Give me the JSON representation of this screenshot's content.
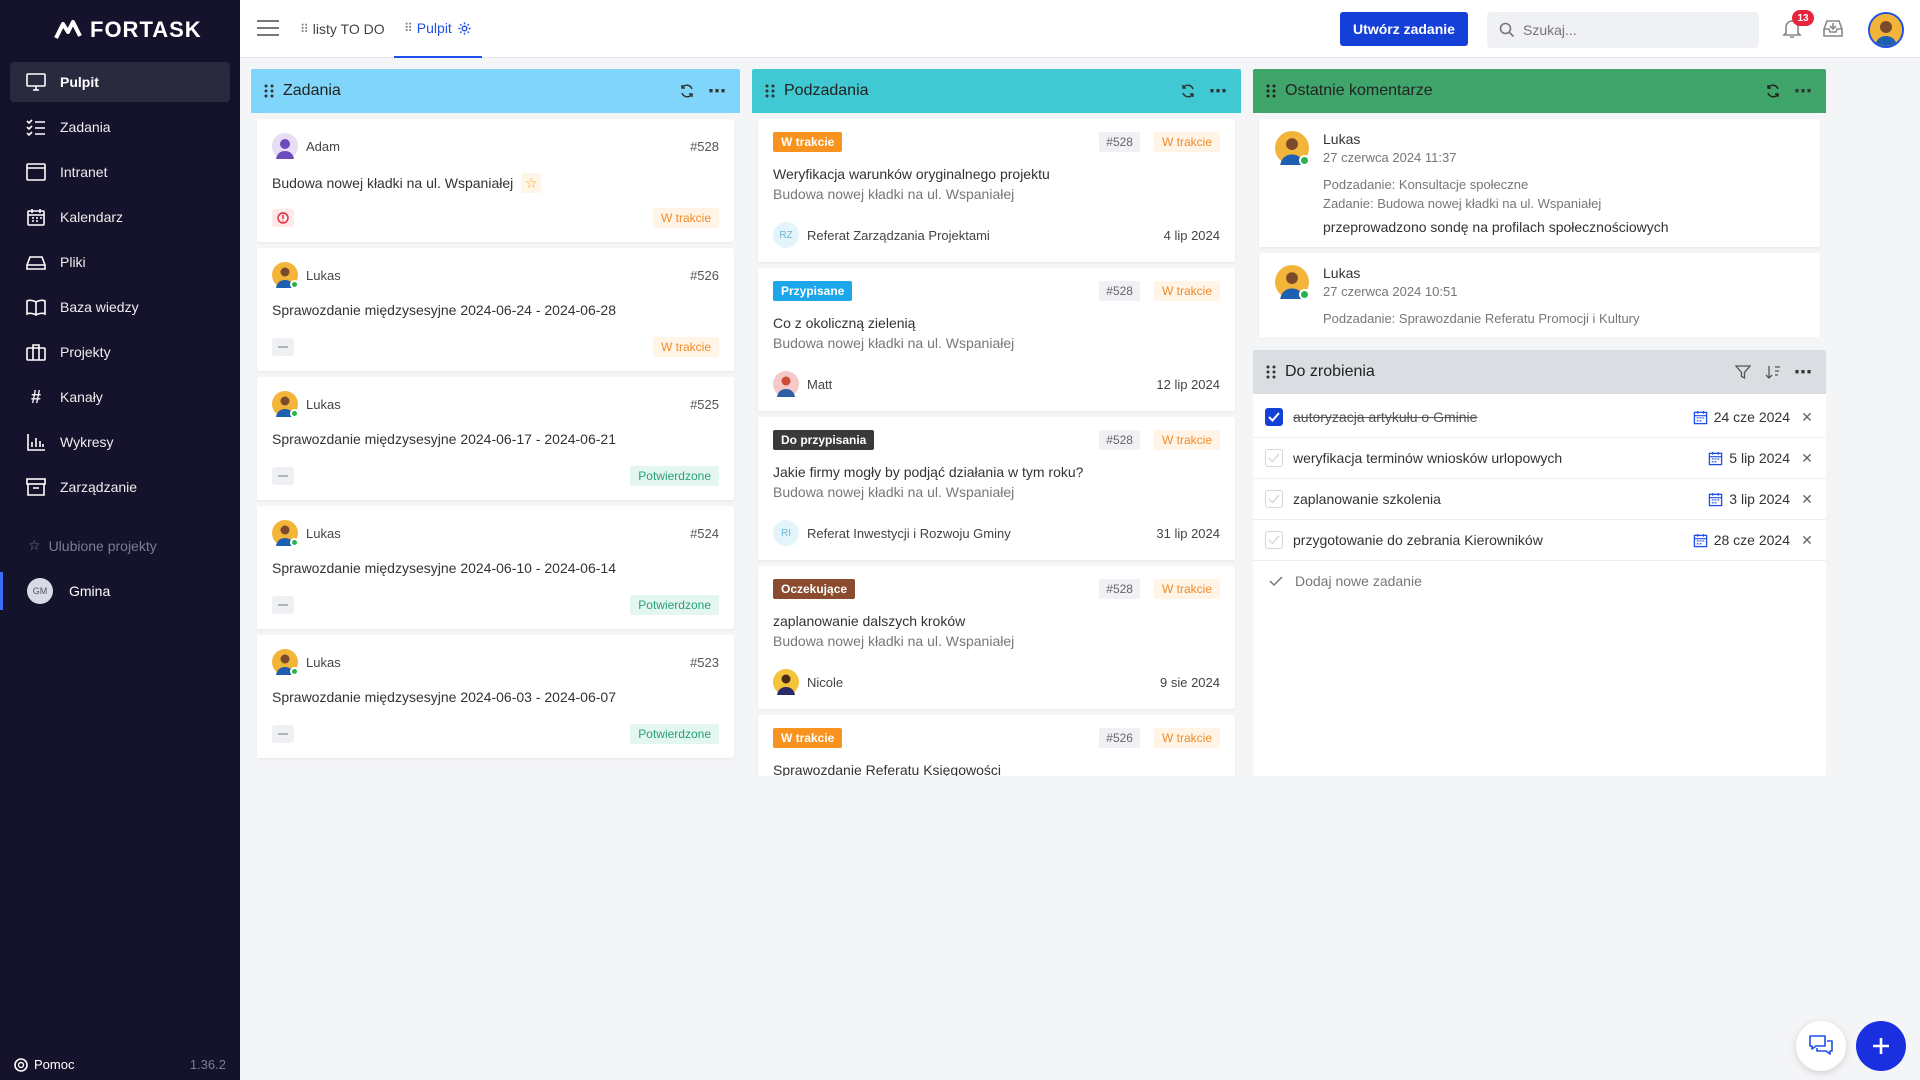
{
  "app": {
    "name": "FORTASK",
    "version": "1.36.2",
    "help_label": "Pomoc"
  },
  "sidebar": {
    "items": [
      {
        "label": "Pulpit",
        "icon": "monitor-icon"
      },
      {
        "label": "Zadania",
        "icon": "list-check-icon"
      },
      {
        "label": "Intranet",
        "icon": "browser-icon"
      },
      {
        "label": "Kalendarz",
        "icon": "calendar-icon"
      },
      {
        "label": "Pliki",
        "icon": "drive-icon"
      },
      {
        "label": "Baza wiedzy",
        "icon": "book-icon"
      },
      {
        "label": "Projekty",
        "icon": "briefcase-icon"
      },
      {
        "label": "Kanały",
        "icon": "hash-icon"
      },
      {
        "label": "Wykresy",
        "icon": "bar-chart-icon"
      },
      {
        "label": "Zarządzanie",
        "icon": "archive-icon"
      }
    ],
    "favorites_title": "Ulubione projekty",
    "project": {
      "initials": "GM",
      "name": "Gmina"
    }
  },
  "topbar": {
    "tabs": [
      {
        "label": "listy TO DO"
      },
      {
        "label": "Pulpit"
      }
    ],
    "create_button": "Utwórz zadanie",
    "search_placeholder": "Szukaj...",
    "notifications_count": "13"
  },
  "widgets": {
    "tasks": {
      "title": "Zadania",
      "header_color": "#7fd6fa",
      "items": [
        {
          "user": "Adam",
          "id": "#528",
          "title": "Budowa nowej kładki na ul. Wspaniałej",
          "starred": true,
          "priority": "high",
          "status": "W trakcie"
        },
        {
          "user": "Lukas",
          "id": "#526",
          "title": "Sprawozdanie międzysesyjne 2024-06-24 - 2024-06-28",
          "priority": "low",
          "status": "W trakcie"
        },
        {
          "user": "Lukas",
          "id": "#525",
          "title": "Sprawozdanie międzysesyjne 2024-06-17 - 2024-06-21",
          "priority": "low",
          "status": "Potwierdzone"
        },
        {
          "user": "Lukas",
          "id": "#524",
          "title": "Sprawozdanie międzysesyjne 2024-06-10 - 2024-06-14",
          "priority": "low",
          "status": "Potwierdzone"
        },
        {
          "user": "Lukas",
          "id": "#523",
          "title": "Sprawozdanie międzysesyjne 2024-06-03 - 2024-06-07",
          "priority": "low",
          "status": "Potwierdzone"
        }
      ]
    },
    "subtasks": {
      "title": "Podzadania",
      "header_color": "#40c9d2",
      "items": [
        {
          "label": "W trakcie",
          "label_color": "orange",
          "id": "#528",
          "status": "W trakcie",
          "title": "Weryfikacja warunków oryginalnego projektu",
          "project": "Budowa nowej kładki na ul. Wspaniałej",
          "assignee_initials": "RZ",
          "assignee": "Referat Zarządzania Projektami",
          "date": "4 lip 2024"
        },
        {
          "label": "Przypisane",
          "label_color": "blue",
          "id": "#528",
          "status": "W trakcie",
          "title": "Co z okoliczną zielenią",
          "project": "Budowa nowej kładki na ul. Wspaniałej",
          "assignee": "Matt",
          "date": "12 lip 2024"
        },
        {
          "label": "Do przypisania",
          "label_color": "dark",
          "id": "#528",
          "status": "W trakcie",
          "title": "Jakie firmy mogły by podjąć działania w tym roku?",
          "project": "Budowa nowej kładki na ul. Wspaniałej",
          "assignee_initials": "RI",
          "assignee": "Referat Inwestycji i Rozwoju Gminy",
          "date": "31 lip 2024"
        },
        {
          "label": "Oczekujące",
          "label_color": "brown",
          "id": "#528",
          "status": "W trakcie",
          "title": "zaplanowanie dalszych kroków",
          "project": "Budowa nowej kładki na ul. Wspaniałej",
          "assignee": "Nicole",
          "date": "9 sie 2024"
        },
        {
          "label": "W trakcie",
          "label_color": "orange",
          "id": "#526",
          "status": "W trakcie",
          "title": "Sprawozdanie Referatu Księgowości"
        }
      ]
    },
    "comments": {
      "title": "Ostatnie komentarze",
      "header_color": "#3fa56a",
      "items": [
        {
          "author": "Lukas",
          "date": "27 czerwca 2024 11:37",
          "subtask": "Podzadanie: Konsultacje społeczne",
          "task": "Zadanie: Budowa nowej kładki na ul. Wspaniałej",
          "text": "przeprowadzono sondę na profilach społecznościowych"
        },
        {
          "author": "Lukas",
          "date": "27 czerwca 2024 10:51",
          "subtask": "Podzadanie: Sprawozdanie Referatu Promocji i Kultury"
        }
      ]
    },
    "todo": {
      "title": "Do zrobienia",
      "header_color": "#dadde2",
      "items": [
        {
          "text": "autoryzacja artykułu o Gminie",
          "done": true,
          "date": "24 cze 2024"
        },
        {
          "text": "weryfikacja terminów wniosków urlopowych",
          "done": false,
          "date": "5 lip 2024"
        },
        {
          "text": "zaplanowanie szkolenia",
          "done": false,
          "date": "3 lip 2024"
        },
        {
          "text": "przygotowanie do zebrania Kierowników",
          "done": false,
          "date": "28 cze 2024"
        }
      ],
      "add_label": "Dodaj nowe zadanie"
    }
  }
}
